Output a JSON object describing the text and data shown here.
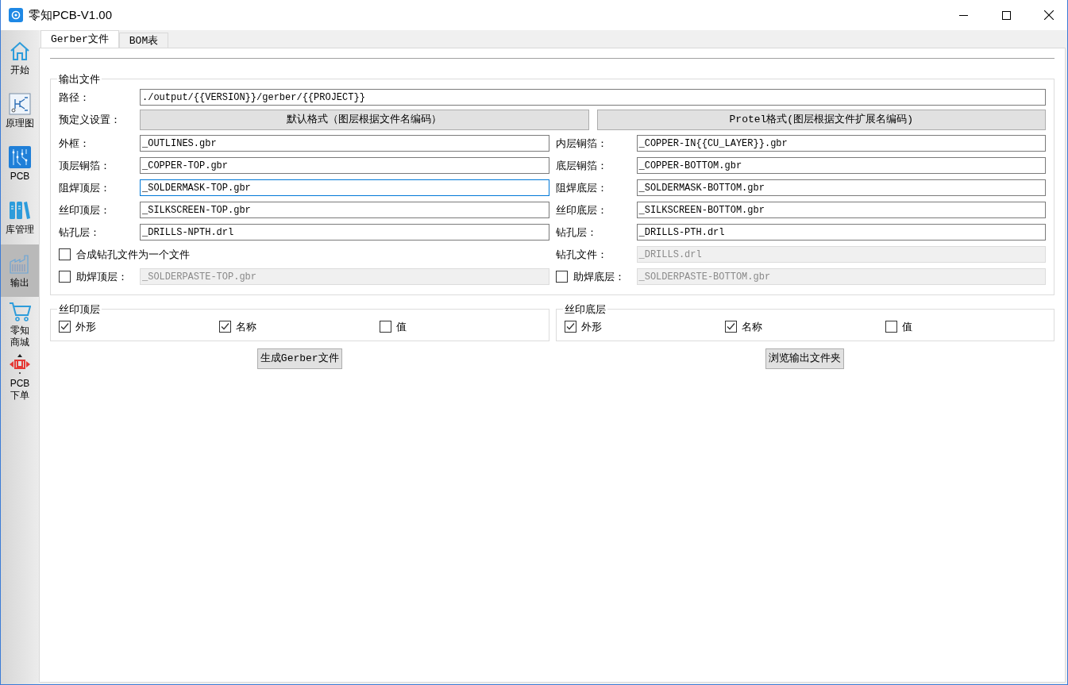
{
  "window": {
    "title": "零知PCB-V1.00"
  },
  "sidebar": {
    "items": [
      {
        "kind": "home",
        "label": "开始",
        "selected": false
      },
      {
        "kind": "schematic",
        "label": "原理图",
        "selected": false
      },
      {
        "kind": "pcb",
        "label": "PCB",
        "selected": false
      },
      {
        "kind": "library",
        "label": "库管理",
        "selected": false
      },
      {
        "kind": "output",
        "label": "输出",
        "selected": true
      },
      {
        "kind": "shop",
        "label": "零知商城",
        "selected": false
      },
      {
        "kind": "order",
        "label": "PCB\n下单",
        "selected": false
      }
    ]
  },
  "tabs": [
    {
      "label": "Gerber文件",
      "selected": true
    },
    {
      "label": "BOM表",
      "selected": false
    }
  ],
  "output_files": {
    "title": "输出文件",
    "path": {
      "label": "路径：",
      "value": "./output/{{VERSION}}/gerber/{{PROJECT}}"
    },
    "preset": {
      "label": "预定义设置：",
      "buttons": [
        "默认格式（图层根据文件名编码）",
        "Protel格式(图层根据文件扩展名编码)"
      ]
    },
    "columns": [
      [
        {
          "kind": "field",
          "label": "外框：",
          "value": "_OUTLINES.gbr",
          "focused": false,
          "disabled": false
        },
        {
          "kind": "field",
          "label": "顶层铜箔：",
          "value": "_COPPER-TOP.gbr",
          "focused": false,
          "disabled": false
        },
        {
          "kind": "field",
          "label": "阻焊顶层：",
          "value": "_SOLDERMASK-TOP.gbr",
          "focused": true,
          "disabled": false
        },
        {
          "kind": "field",
          "label": "丝印顶层：",
          "value": "_SILKSCREEN-TOP.gbr",
          "focused": false,
          "disabled": false
        },
        {
          "kind": "field",
          "label": "钻孔层：",
          "value": "_DRILLS-NPTH.drl",
          "focused": false,
          "disabled": false
        },
        {
          "kind": "checkbox",
          "label": "合成钻孔文件为一个文件",
          "checked": false
        },
        {
          "kind": "checkbox-field",
          "label": "助焊顶层：",
          "value": "_SOLDERPASTE-TOP.gbr",
          "checked": false,
          "focused": false,
          "disabled": true
        }
      ],
      [
        {
          "kind": "field",
          "label": "内层铜箔：",
          "value": "_COPPER-IN{{CU_LAYER}}.gbr",
          "focused": false,
          "disabled": false
        },
        {
          "kind": "field",
          "label": "底层铜箔：",
          "value": "_COPPER-BOTTOM.gbr",
          "focused": false,
          "disabled": false
        },
        {
          "kind": "field",
          "label": "阻焊底层：",
          "value": "_SOLDERMASK-BOTTOM.gbr",
          "focused": false,
          "disabled": false
        },
        {
          "kind": "field",
          "label": "丝印底层：",
          "value": "_SILKSCREEN-BOTTOM.gbr",
          "focused": false,
          "disabled": false
        },
        {
          "kind": "field",
          "label": "钻孔层：",
          "value": "_DRILLS-PTH.drl",
          "focused": false,
          "disabled": false
        },
        {
          "kind": "field",
          "label": "钻孔文件：",
          "value": "_DRILLS.drl",
          "focused": false,
          "disabled": true
        },
        {
          "kind": "checkbox-field",
          "label": "助焊底层：",
          "value": "_SOLDERPASTE-BOTTOM.gbr",
          "checked": false,
          "focused": false,
          "disabled": true
        }
      ]
    ]
  },
  "silkscreen_groups": [
    {
      "title": "丝印顶层",
      "options": [
        {
          "label": "外形",
          "checked": true
        },
        {
          "label": "名称",
          "checked": true
        },
        {
          "label": "值",
          "checked": false
        }
      ]
    },
    {
      "title": "丝印底层",
      "options": [
        {
          "label": "外形",
          "checked": true
        },
        {
          "label": "名称",
          "checked": true
        },
        {
          "label": "值",
          "checked": false
        }
      ]
    }
  ],
  "actions": [
    "生成Gerber文件",
    "浏览输出文件夹"
  ]
}
